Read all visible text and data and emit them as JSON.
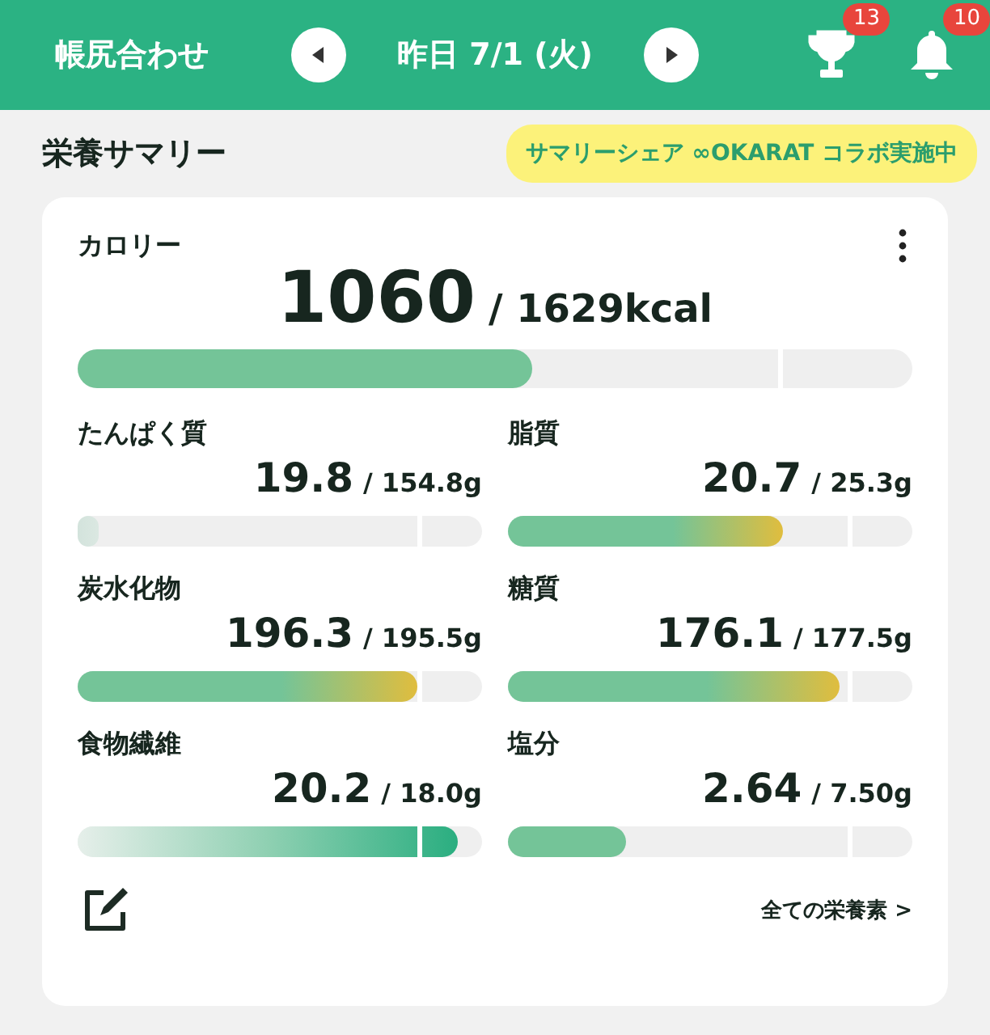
{
  "header": {
    "title": "帳尻合わせ",
    "date": "昨日 7/1 (火)",
    "trophy_badge": "13",
    "bell_badge": "10"
  },
  "summary": {
    "title": "栄養サマリー",
    "banner": "サマリーシェア ∞OKARAT コラボ実施中"
  },
  "calorie": {
    "label": "カロリー",
    "value": "1060",
    "target": "/ 1629kcal",
    "level": 0.545,
    "kind": "ok"
  },
  "nutrients": [
    {
      "label": "たんぱく質",
      "value": "19.8",
      "target": "/ 154.8g",
      "level": 0.05,
      "kind": "low"
    },
    {
      "label": "脂質",
      "value": "20.7",
      "target": "/ 25.3g",
      "level": 0.68,
      "kind": "near"
    },
    {
      "label": "炭水化物",
      "value": "196.3",
      "target": "/ 195.5g",
      "level": 0.84,
      "kind": "near"
    },
    {
      "label": "糖質",
      "value": "176.1",
      "target": "/ 177.5g",
      "level": 0.82,
      "kind": "near"
    },
    {
      "label": "食物繊維",
      "value": "20.2",
      "target": "/ 18.0g",
      "level": 0.94,
      "kind": "over"
    },
    {
      "label": "塩分",
      "value": "2.64",
      "target": "/ 7.50g",
      "level": 0.29,
      "kind": "ok"
    }
  ],
  "footer": {
    "link": "全ての栄養素 >"
  }
}
